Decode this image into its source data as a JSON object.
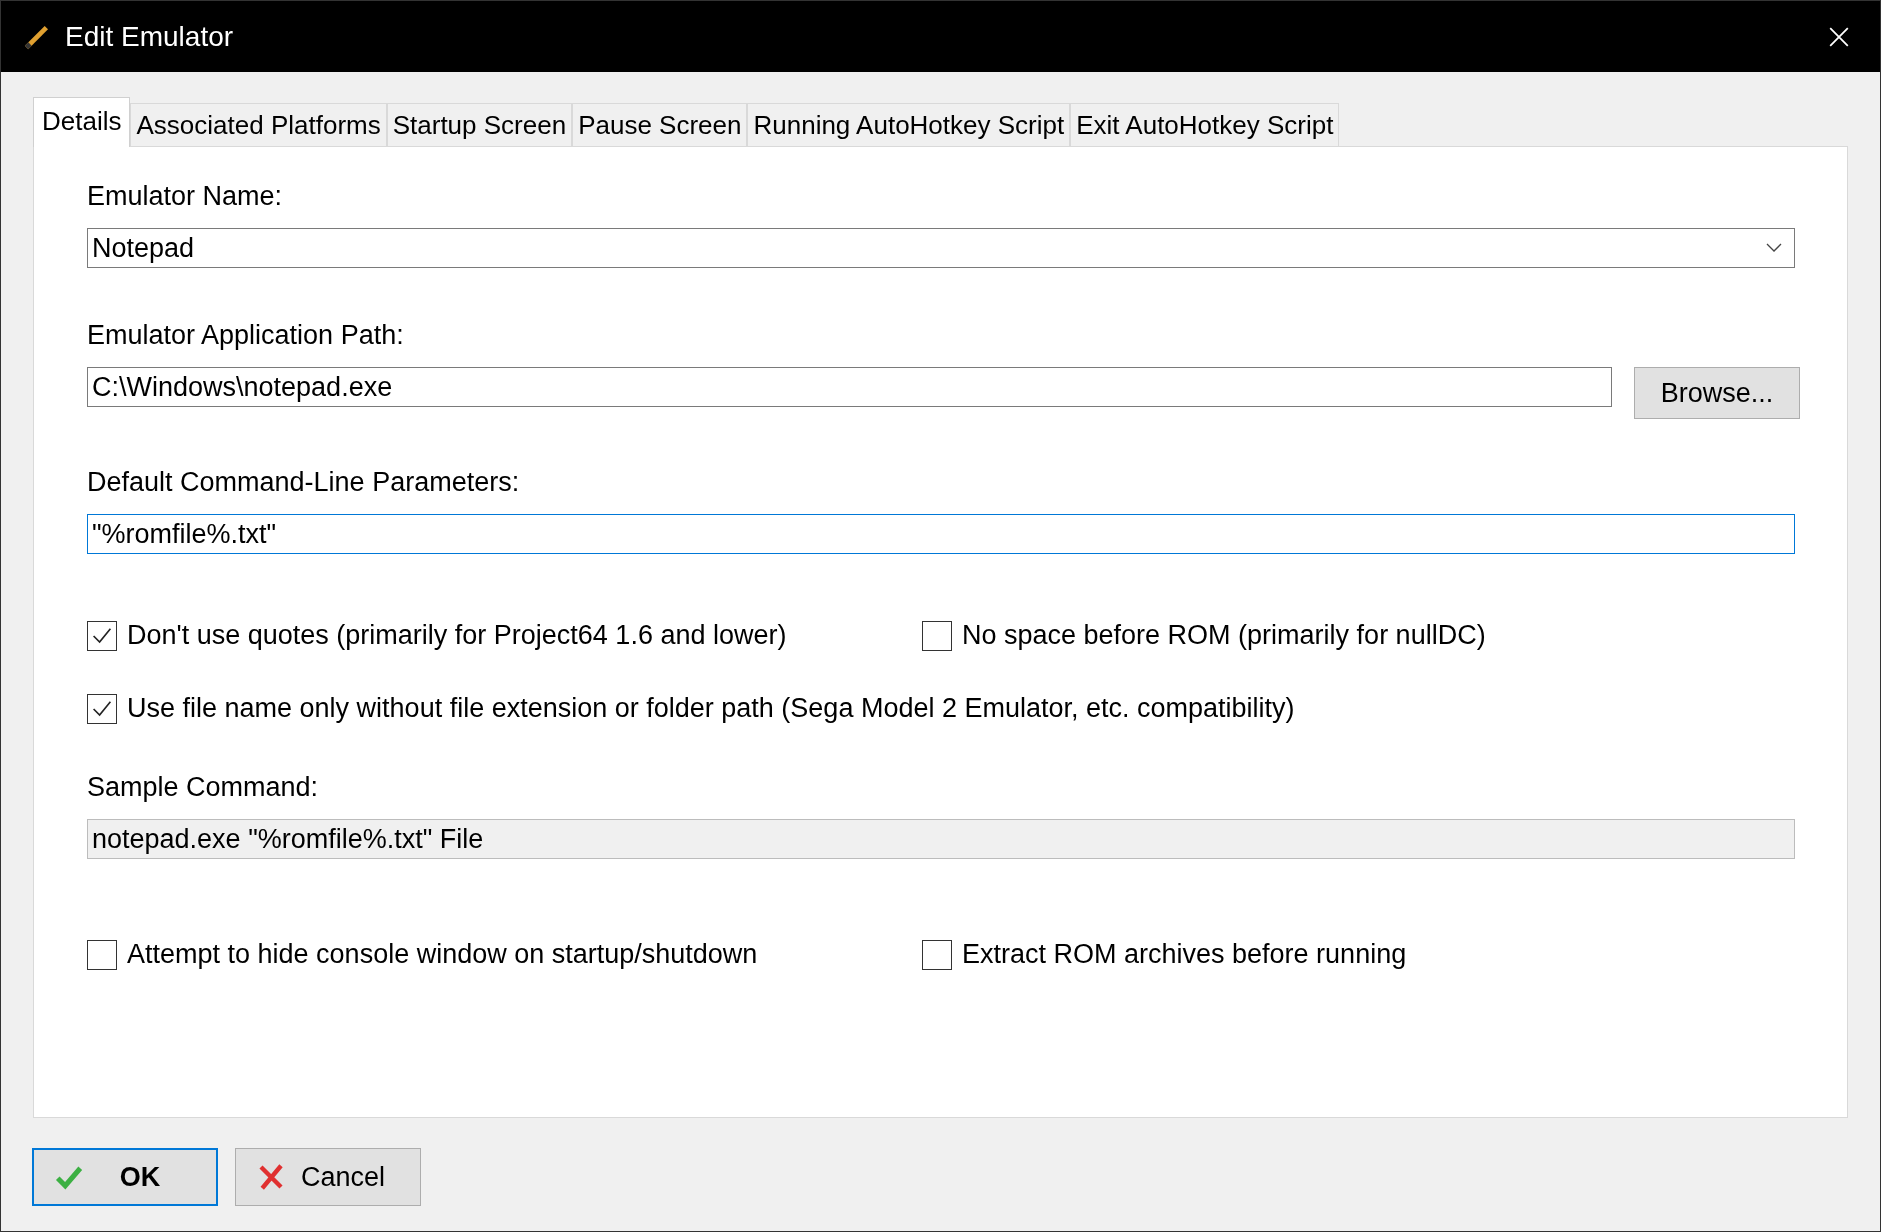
{
  "window": {
    "title": "Edit Emulator"
  },
  "tabs": [
    {
      "label": "Details",
      "selected": true
    },
    {
      "label": "Associated Platforms",
      "selected": false
    },
    {
      "label": "Startup Screen",
      "selected": false
    },
    {
      "label": "Pause Screen",
      "selected": false
    },
    {
      "label": "Running AutoHotkey Script",
      "selected": false
    },
    {
      "label": "Exit AutoHotkey Script",
      "selected": false
    }
  ],
  "emulator_name": {
    "label": "Emulator Name:",
    "value": "Notepad"
  },
  "application_path": {
    "label": "Emulator Application Path:",
    "value": "C:\\Windows\\notepad.exe",
    "button": "Browse..."
  },
  "parameters": {
    "label": "Default Command-Line Parameters:",
    "value": "\"%romfile%.txt\"",
    "focused": true
  },
  "option_rows": [
    [
      {
        "label": "Don't use quotes (primarily for Project64 1.6 and lower)",
        "checked": true
      },
      {
        "label": "No space before ROM (primarily for nullDC)",
        "checked": false
      }
    ],
    [
      {
        "label": "Use file name only without file extension or folder path (Sega Model 2 Emulator, etc. compatibility)",
        "checked": true
      }
    ]
  ],
  "sample_command": {
    "label": "Sample Command:",
    "value": "notepad.exe \"%romfile%.txt\" File"
  },
  "bottom_options": [
    {
      "label": "Attempt to hide console window on startup/shutdown",
      "checked": false
    },
    {
      "label": "Extract ROM archives before running",
      "checked": false
    }
  ],
  "buttons": [
    {
      "label": "OK",
      "kind": "confirm",
      "default": true
    },
    {
      "label": "Cancel",
      "kind": "cancel",
      "default": false
    }
  ]
}
